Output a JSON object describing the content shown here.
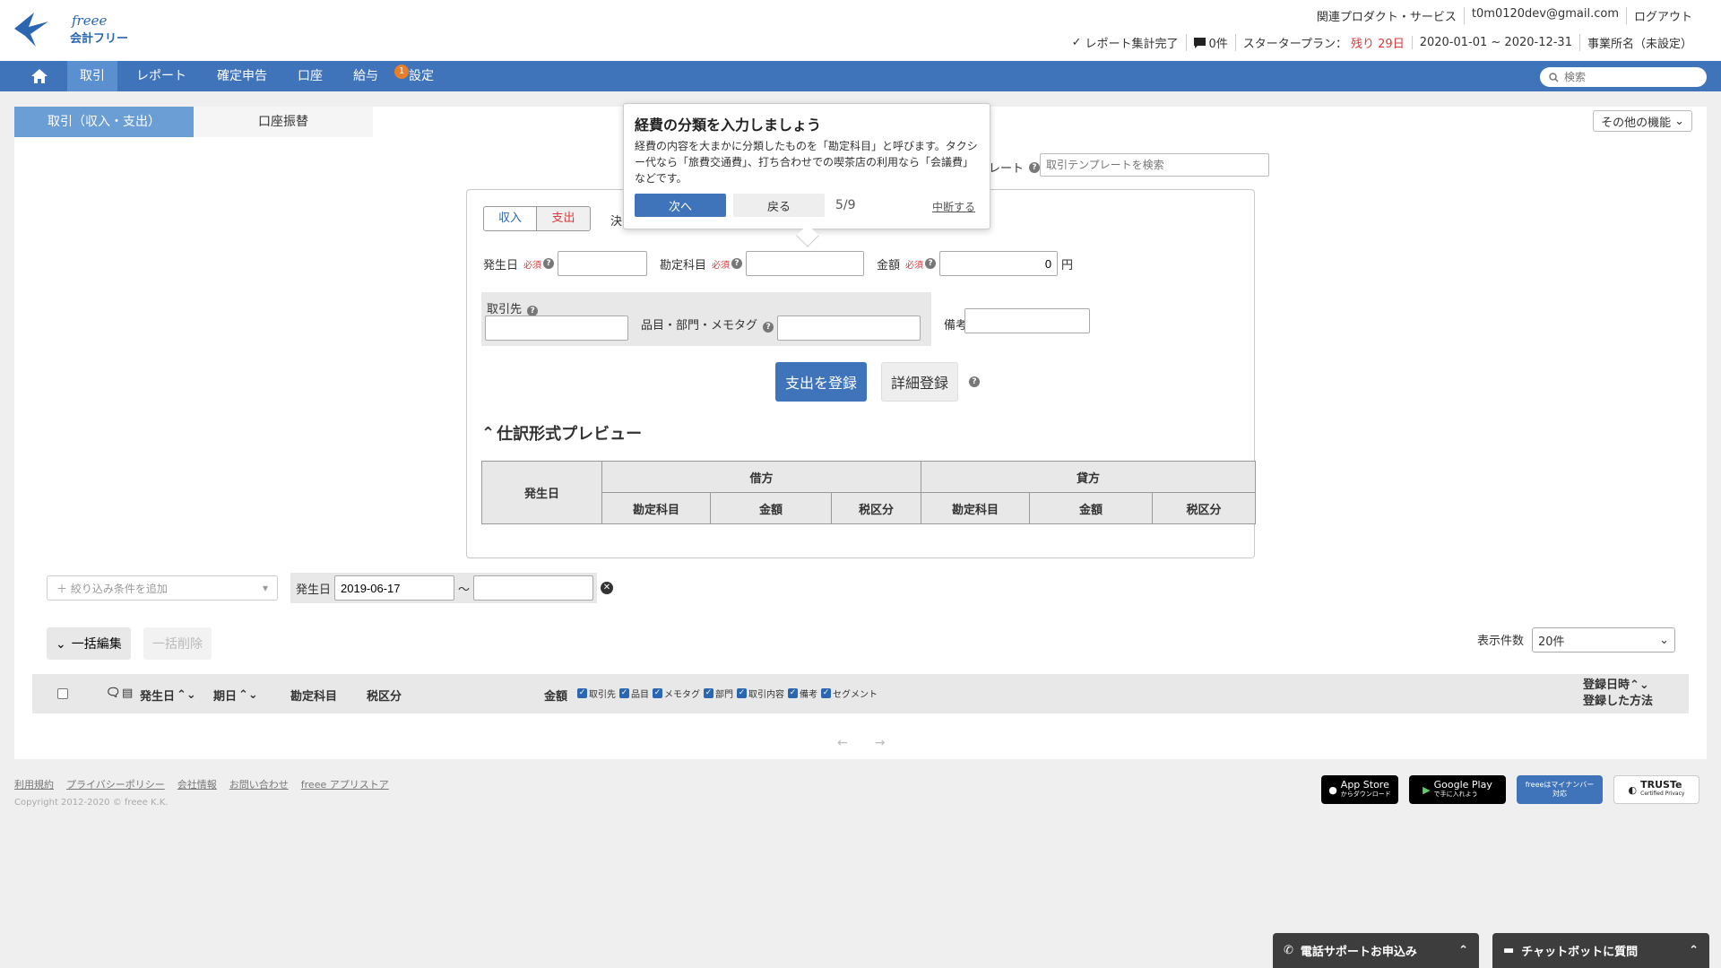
{
  "header": {
    "logo_brand": "freee",
    "logo_product": "会計フリー",
    "links": [
      "関連プロダクト・サービス",
      "t0m0120dev@gmail.com",
      "ログアウト"
    ],
    "report_status": "レポート集計完了",
    "messages": "0件",
    "plan_label": "スタータープラン：",
    "plan_remaining": "残り 29日",
    "period": "2020-01-01 ~ 2020-12-31",
    "office": "事業所名（未設定）"
  },
  "nav": {
    "items": [
      "取引",
      "レポート",
      "確定申告",
      "口座",
      "給与",
      "設定"
    ],
    "badge_count": "1",
    "search_placeholder": "検索"
  },
  "tabs": [
    "取引（収入・支出）",
    "口座振替"
  ],
  "other_features": "その他の機能",
  "template": {
    "label": "レート",
    "placeholder": "取引テンプレートを検索"
  },
  "form": {
    "income": "収入",
    "expense": "支出",
    "decide_label": "決",
    "date_label": "発生日",
    "account_label": "勘定科目",
    "amount_label": "金額",
    "required": "必須",
    "amount_value": "0",
    "yen": "円",
    "partner_label": "取引先",
    "item_label": "品目・部門・メモタグ",
    "note_label": "備考",
    "register_button": "支出を登録",
    "detail_button": "詳細登録"
  },
  "preview": {
    "title": "仕訳形式プレビュー",
    "date_col": "発生日",
    "debit": "借方",
    "credit": "貸方",
    "sub_cols": [
      "勘定科目",
      "金額",
      "税区分"
    ]
  },
  "filter": {
    "add_condition": "＋ 絞り込み条件を追加",
    "date_label": "発生日",
    "date_from": "2019-06-17",
    "tilde": "〜",
    "date_to": ""
  },
  "list": {
    "bulk_edit": "一括編集",
    "bulk_delete": "一括削除",
    "show_count_label": "表示件数",
    "show_count_value": "20件",
    "col_date": "発生日",
    "col_due": "期日",
    "col_account": "勘定科目",
    "col_tax": "税区分",
    "col_amount": "金額",
    "col_options": [
      "取引先",
      "品目",
      "メモタグ",
      "部門",
      "取引内容",
      "備考",
      "セグメント"
    ],
    "col_registered": "登録日時",
    "col_method": "登録した方法"
  },
  "pager": {
    "prev": "←",
    "next": "→"
  },
  "footer": {
    "links": [
      "利用規約",
      "プライバシーポリシー",
      "会社情報",
      "お問い合わせ",
      "freee アプリストア"
    ],
    "copyright": "Copyright 2012-2020 © freee K.K.",
    "badges": {
      "appstore_main": "App Store",
      "appstore_sub": "からダウンロード",
      "google_main": "Google Play",
      "google_sub": "で手に入れよう",
      "mynumber": "freeeはマイナンバー対応",
      "truste_main": "TRUSTe",
      "truste_sub": "Certified Privacy"
    }
  },
  "support": {
    "phone": "電話サポートお申込み",
    "chat": "チャットボットに質問"
  },
  "tooltip": {
    "title": "経費の分類を入力しましょう",
    "body": "経費の内容を大まかに分類したものを「勘定科目」と呼びます。タクシー代なら「旅費交通費」、打ち合わせでの喫茶店の利用なら「会議費」などです。",
    "next": "次へ",
    "back": "戻る",
    "step": "5/9",
    "abort": "中断する"
  },
  "colors": {
    "nav_blue": "#3f73ba",
    "tab_active": "#6b9ed4",
    "required_red": "#d93a3a",
    "badge_orange": "#e87d2a"
  },
  "icons": [
    "home-icon",
    "search-icon",
    "check-icon",
    "message-icon",
    "help-icon",
    "chevron-down-icon",
    "chevron-up-icon",
    "phone-icon",
    "chat-icon",
    "apple-icon",
    "play-icon",
    "clear-icon"
  ]
}
